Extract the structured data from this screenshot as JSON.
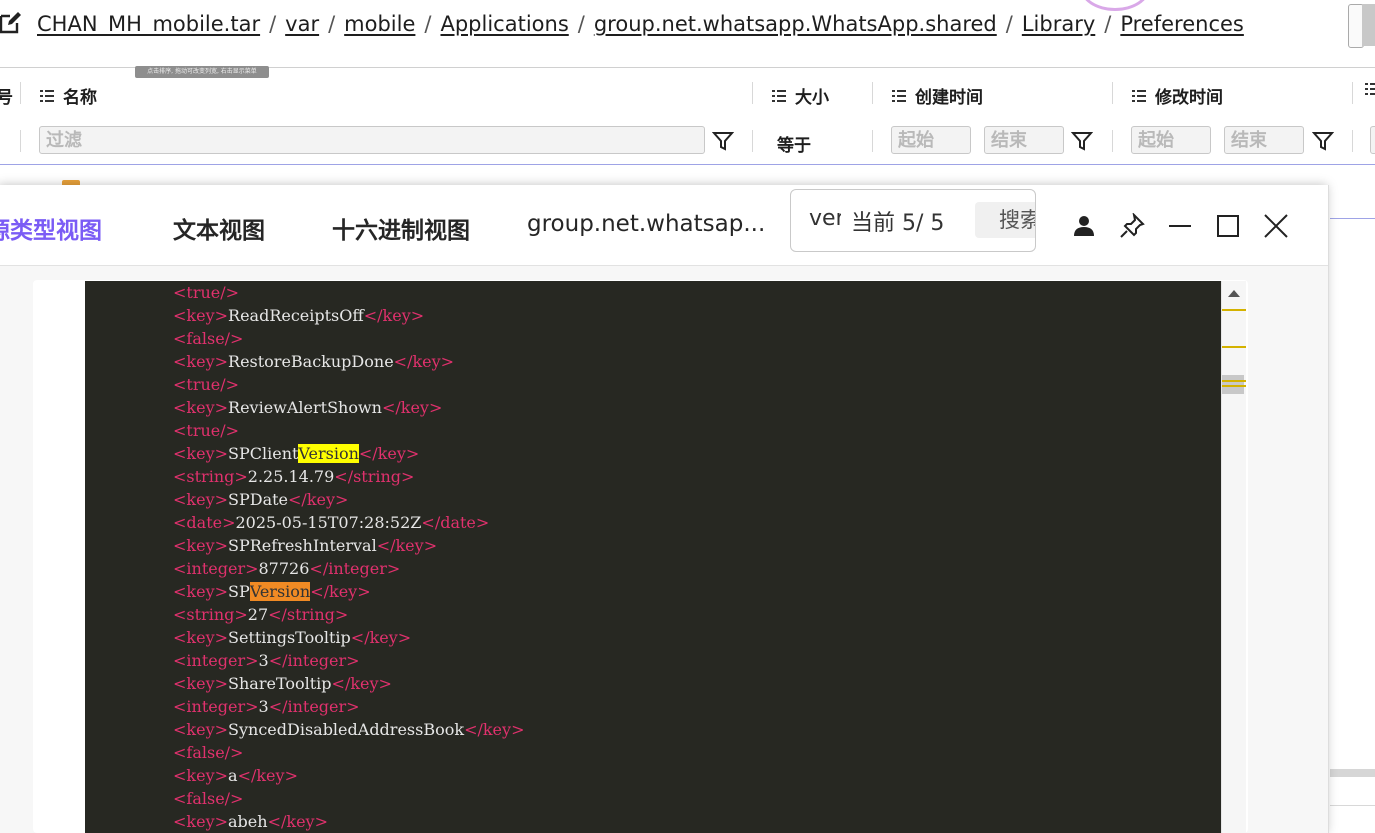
{
  "breadcrumb": [
    "CHAN_MH_mobile.tar",
    "var",
    "mobile",
    "Applications",
    "group.net.whatsapp.WhatsApp.shared",
    "Library",
    "Preferences"
  ],
  "breadcrumb_separator": "/",
  "tooltip_text": "点击排序, 拖动可改变列宽, 右击显示菜单",
  "table": {
    "col_index_tail": "号",
    "col_name": "名称",
    "col_size": "大小",
    "col_created": "创建时间",
    "col_modified": "修改时间"
  },
  "filters": {
    "name_placeholder": "过滤",
    "size_operator": "等于",
    "created_start": "起始",
    "created_end": "结束",
    "modified_start": "起始",
    "modified_end": "结束"
  },
  "viewer": {
    "tabs": {
      "source_type_view": "源类型视图",
      "text_view": "文本视图",
      "hex_view": "十六进制视图",
      "file_name": "group.net.whatsap..."
    },
    "active_tab": "source_type_view",
    "search": {
      "query": "ver",
      "status": "当前  5/  5",
      "button": "搜索"
    },
    "controls": [
      "user-icon",
      "pin-icon",
      "minimize-icon",
      "maximize-icon",
      "close-icon"
    ]
  },
  "code_lines": [
    [
      {
        "t": "tag",
        "v": "<true/>"
      }
    ],
    [
      {
        "t": "tag",
        "v": "<key>"
      },
      {
        "t": "txt",
        "v": "ReadReceiptsOff"
      },
      {
        "t": "tag",
        "v": "</key>"
      }
    ],
    [
      {
        "t": "tag",
        "v": "<false/>"
      }
    ],
    [
      {
        "t": "tag",
        "v": "<key>"
      },
      {
        "t": "txt",
        "v": "RestoreBackupDone"
      },
      {
        "t": "tag",
        "v": "</key>"
      }
    ],
    [
      {
        "t": "tag",
        "v": "<true/>"
      }
    ],
    [
      {
        "t": "tag",
        "v": "<key>"
      },
      {
        "t": "txt",
        "v": "ReviewAlertShown"
      },
      {
        "t": "tag",
        "v": "</key>"
      }
    ],
    [
      {
        "t": "tag",
        "v": "<true/>"
      }
    ],
    [
      {
        "t": "tag",
        "v": "<key>"
      },
      {
        "t": "txt",
        "v": "SPClient"
      },
      {
        "t": "hly",
        "v": "Version"
      },
      {
        "t": "tag",
        "v": "</key>"
      }
    ],
    [
      {
        "t": "tag",
        "v": "<string>"
      },
      {
        "t": "txt",
        "v": "2.25.14.79"
      },
      {
        "t": "tag",
        "v": "</string>"
      }
    ],
    [
      {
        "t": "tag",
        "v": "<key>"
      },
      {
        "t": "txt",
        "v": "SPDate"
      },
      {
        "t": "tag",
        "v": "</key>"
      }
    ],
    [
      {
        "t": "tag",
        "v": "<date>"
      },
      {
        "t": "txt",
        "v": "2025-05-15T07:28:52Z"
      },
      {
        "t": "tag",
        "v": "</date>"
      }
    ],
    [
      {
        "t": "tag",
        "v": "<key>"
      },
      {
        "t": "txt",
        "v": "SPRefreshInterval"
      },
      {
        "t": "tag",
        "v": "</key>"
      }
    ],
    [
      {
        "t": "tag",
        "v": "<integer>"
      },
      {
        "t": "txt",
        "v": "87726"
      },
      {
        "t": "tag",
        "v": "</integer>"
      }
    ],
    [
      {
        "t": "tag",
        "v": "<key>"
      },
      {
        "t": "txt",
        "v": "SP"
      },
      {
        "t": "hlo",
        "v": "Version"
      },
      {
        "t": "tag",
        "v": "</key>"
      }
    ],
    [
      {
        "t": "tag",
        "v": "<string>"
      },
      {
        "t": "txt",
        "v": "27"
      },
      {
        "t": "tag",
        "v": "</string>"
      }
    ],
    [
      {
        "t": "tag",
        "v": "<key>"
      },
      {
        "t": "txt",
        "v": "SettingsTooltip"
      },
      {
        "t": "tag",
        "v": "</key>"
      }
    ],
    [
      {
        "t": "tag",
        "v": "<integer>"
      },
      {
        "t": "txt",
        "v": "3"
      },
      {
        "t": "tag",
        "v": "</integer>"
      }
    ],
    [
      {
        "t": "tag",
        "v": "<key>"
      },
      {
        "t": "txt",
        "v": "ShareTooltip"
      },
      {
        "t": "tag",
        "v": "</key>"
      }
    ],
    [
      {
        "t": "tag",
        "v": "<integer>"
      },
      {
        "t": "txt",
        "v": "3"
      },
      {
        "t": "tag",
        "v": "</integer>"
      }
    ],
    [
      {
        "t": "tag",
        "v": "<key>"
      },
      {
        "t": "txt",
        "v": "SyncedDisabledAddressBook"
      },
      {
        "t": "tag",
        "v": "</key>"
      }
    ],
    [
      {
        "t": "tag",
        "v": "<false/>"
      }
    ],
    [
      {
        "t": "tag",
        "v": "<key>"
      },
      {
        "t": "txt",
        "v": "a"
      },
      {
        "t": "tag",
        "v": "</key>"
      }
    ],
    [
      {
        "t": "tag",
        "v": "<false/>"
      }
    ],
    [
      {
        "t": "tag",
        "v": "<key>"
      },
      {
        "t": "txt",
        "v": "abeh"
      },
      {
        "t": "tag",
        "v": "</key>"
      }
    ]
  ],
  "colors": {
    "accent": "#7b5cf5",
    "code_bg": "#272822",
    "tag": "#e0316d",
    "text": "#e6e6e6",
    "highlight_match": "#ffff00",
    "highlight_current": "#f08a24"
  }
}
